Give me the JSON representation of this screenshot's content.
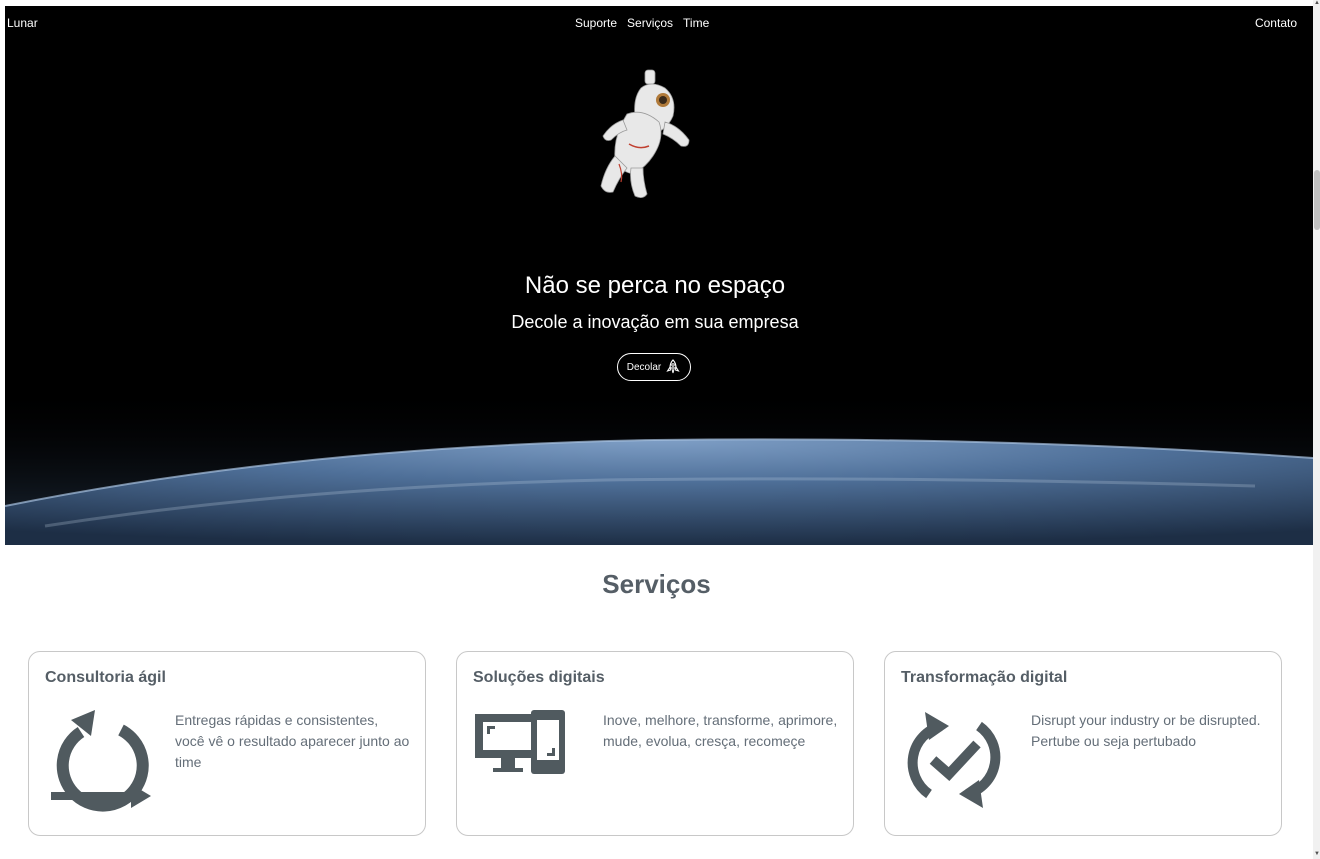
{
  "nav": {
    "brand": "Lunar",
    "links": [
      "Suporte",
      "Serviços",
      "Time"
    ],
    "contact": "Contato"
  },
  "hero": {
    "title": "Não se perca no espaço",
    "subtitle": "Decole a inovação em sua empresa",
    "cta_label": "Decolar",
    "cta_icon": "rocket-icon"
  },
  "services": {
    "title": "Serviços",
    "cards": [
      {
        "title": "Consultoria ágil",
        "text": "Entregas rápidas e consistentes, você vê o resultado aparecer junto ao time",
        "icon": "agile-cycle-icon"
      },
      {
        "title": "Soluções digitais",
        "text": "Inove, melhore, transforme, aprimore, mude, evolua, cresça, recomeçe",
        "icon": "devices-icon"
      },
      {
        "title": "Transformação digital",
        "text": "Disrupt your industry or be disrupted. Pertube ou seja pertubado",
        "icon": "sync-check-icon"
      }
    ]
  },
  "colors": {
    "hero_bg": "#000000",
    "heading": "#555e66",
    "body_text": "#646e78",
    "icon": "#505a5f",
    "card_border": "#c8c8c8"
  }
}
